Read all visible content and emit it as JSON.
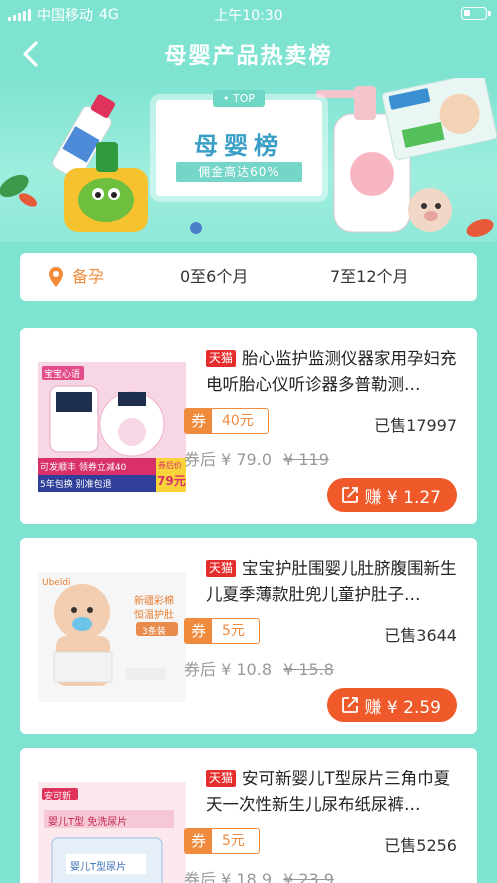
{
  "status_bar": {
    "carrier": "中国移动",
    "network": "4G",
    "time": "上午10:30"
  },
  "nav": {
    "title": "母婴产品热卖榜"
  },
  "banner": {
    "tag": "• TOP",
    "heading": "母婴榜",
    "subtitle": "佣金高达60%"
  },
  "tabs": [
    "备孕",
    "0至6个月",
    "7至12个月"
  ],
  "accent_color": "#f05a2a",
  "theme_color": "#7fe3d2",
  "products": [
    {
      "platform": "天猫",
      "title": "胎心监护监测仪器家用孕妇充电听胎心仪听诊器多普勒测…",
      "coupon_label": "券",
      "coupon_value": "40元",
      "sold": "已售17997",
      "after_label": "券后",
      "price": "¥ 79.0",
      "original_price": "¥ 119",
      "earn": "赚 ¥ 1.27",
      "image_texts": [
        "宝宝心语",
        "可发顺丰 领券立减40",
        "5年包换 别准包退",
        "券后价",
        "79元"
      ]
    },
    {
      "platform": "天猫",
      "title": "宝宝护肚围婴儿肚脐腹围新生儿夏季薄款肚兜儿童护肚子…",
      "coupon_label": "券",
      "coupon_value": "5元",
      "sold": "已售3644",
      "after_label": "券后",
      "price": "¥ 10.8",
      "original_price": "¥ 15.8",
      "earn": "赚 ¥ 2.59",
      "image_texts": [
        "Ubeldi",
        "新疆彩棉",
        "恒温护肚",
        "3条装"
      ]
    },
    {
      "platform": "天猫",
      "title": "安可新婴儿T型尿片三角巾夏天一次性新生儿尿布纸尿裤…",
      "coupon_label": "券",
      "coupon_value": "5元",
      "sold": "已售5256",
      "after_label": "券后",
      "price": "¥ 18.9",
      "original_price": "¥ 23.9",
      "earn": "",
      "image_texts": [
        "安可新",
        "婴儿T型 免洗尿片",
        "婴儿T型尿片"
      ]
    }
  ]
}
